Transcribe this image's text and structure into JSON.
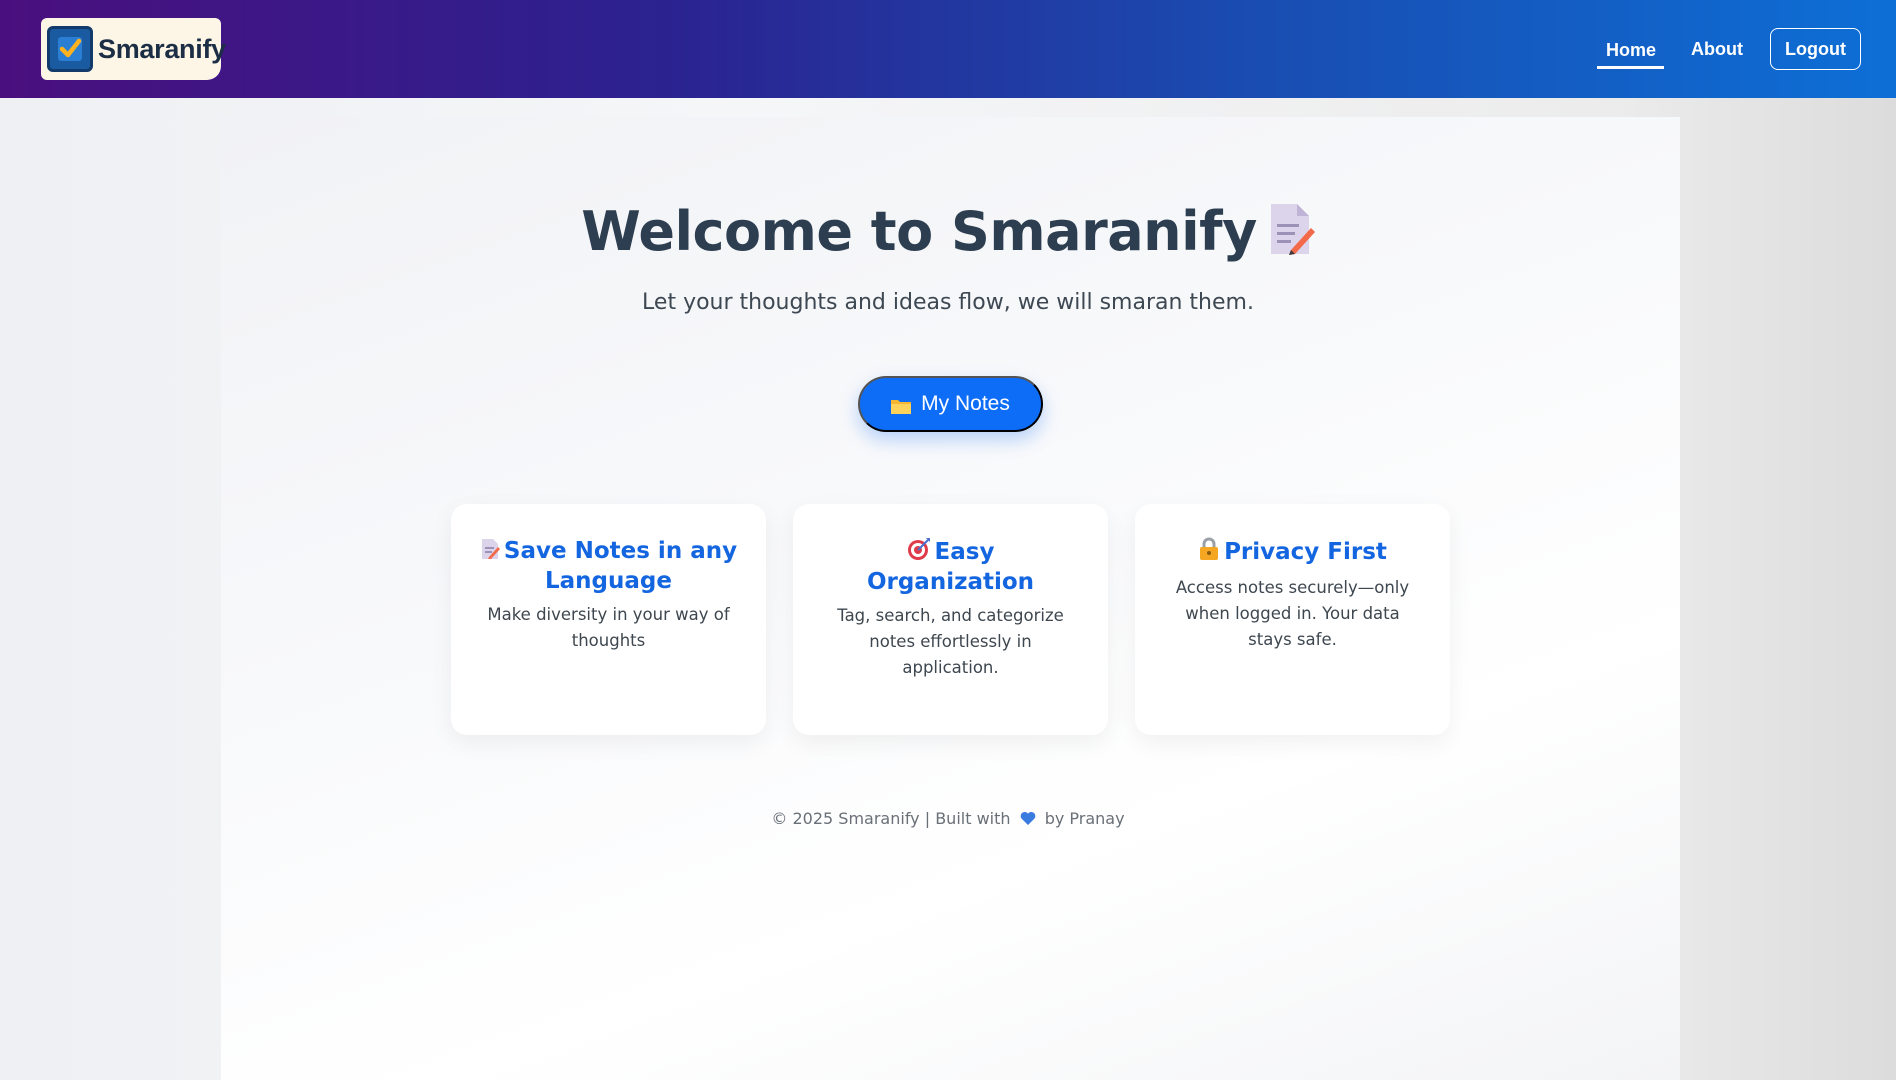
{
  "app": {
    "name": "Smaranify",
    "logo_icon": "checkbox-notebook-icon",
    "brand_colors": {
      "nav_gradient_start": "#4a0f7e",
      "nav_gradient_end": "#0d6fd6",
      "accent": "#0e6df7",
      "title_text": "#2d3e50",
      "card_title": "#1466e0"
    }
  },
  "nav": {
    "home": "Home",
    "about": "About",
    "logout": "Logout",
    "active": "Home"
  },
  "hero": {
    "title": "Welcome to Smaranify",
    "title_icon": "memo-pencil-icon",
    "subtitle": "Let your thoughts and ideas flow, we will smaran them.",
    "cta_label": "My Notes",
    "cta_icon": "folder-icon"
  },
  "features": [
    {
      "icon": "memo-icon",
      "title": "Save Notes in any Language",
      "description": "Make diversity in your way of thoughts"
    },
    {
      "icon": "target-icon",
      "title": "Easy Organization",
      "description": "Tag, search, and categorize notes effortlessly in application."
    },
    {
      "icon": "lock-icon",
      "title": "Privacy First",
      "description": "Access notes securely—only when logged in. Your data stays safe."
    }
  ],
  "footer": {
    "prefix": "© 2025 Smaranify | Built with",
    "heart_icon": "blue-heart-icon",
    "suffix": "by Pranay"
  }
}
